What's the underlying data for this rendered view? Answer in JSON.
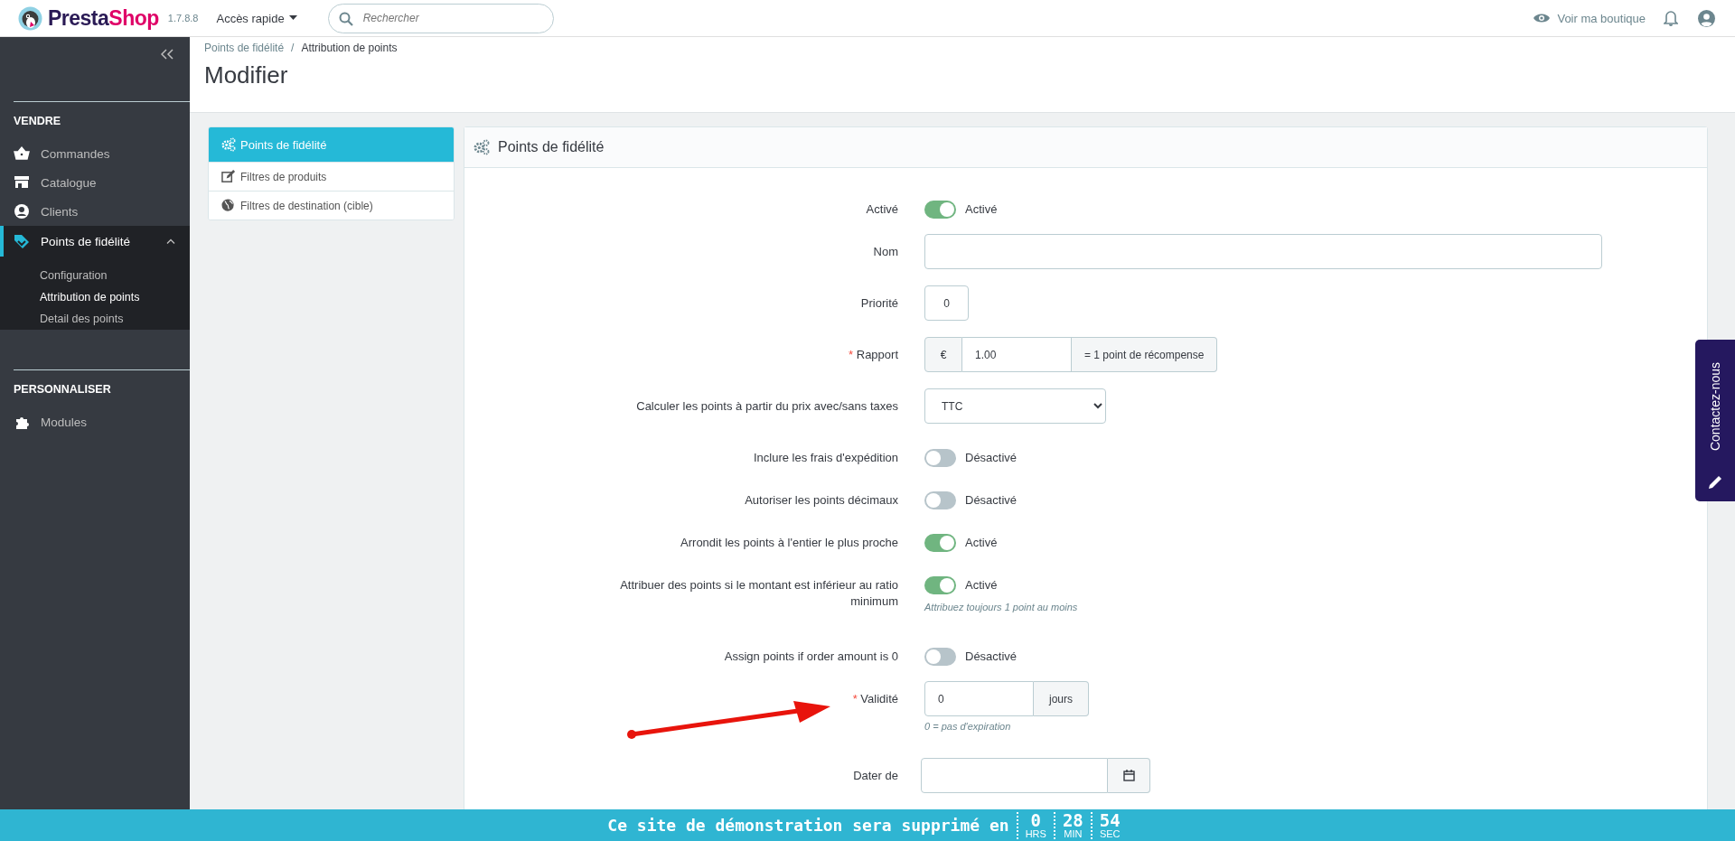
{
  "header": {
    "logo": {
      "dark_part": "Presta",
      "accent_part": "Shop"
    },
    "version": "1.7.8.8",
    "quick_access": "Accès rapide",
    "search": {
      "placeholder": "Rechercher"
    },
    "view_shop": "Voir ma boutique"
  },
  "sidebar": {
    "sections": [
      {
        "title": "VENDRE",
        "items": [
          {
            "label": "Commandes",
            "selected": false,
            "expanded": false
          },
          {
            "label": "Catalogue",
            "selected": false,
            "expanded": false
          },
          {
            "label": "Clients",
            "selected": false,
            "expanded": false
          },
          {
            "label": "Points de fidélité",
            "selected": true,
            "expanded": true,
            "children": [
              {
                "label": "Configuration",
                "selected": false
              },
              {
                "label": "Attribution de points",
                "selected": true
              },
              {
                "label": "Detail des points",
                "selected": false
              }
            ]
          }
        ]
      },
      {
        "title": "PERSONNALISER",
        "items": [
          {
            "label": "Modules",
            "selected": false,
            "expanded": false
          }
        ]
      }
    ]
  },
  "breadcrumb": {
    "separator": "/",
    "items": [
      "Points de fidélité",
      "Attribution de points"
    ]
  },
  "page_title": "Modifier",
  "tabs": [
    {
      "label": "Points de fidélité",
      "selected": true
    },
    {
      "label": "Filtres de produits",
      "selected": false
    },
    {
      "label": "Filtres de destination (cible)",
      "selected": false
    }
  ],
  "form": {
    "title": "Points de fidélité",
    "required_mark": "*",
    "rows": [
      {
        "kind": "switch",
        "label": "Activé",
        "required": false,
        "on": true,
        "state_text": "Activé"
      },
      {
        "kind": "text",
        "label": "Nom",
        "required": false,
        "value": ""
      },
      {
        "kind": "number",
        "label": "Priorité",
        "required": false,
        "value": "0"
      },
      {
        "kind": "ratio",
        "label": "Rapport",
        "required": true,
        "prefix": "€",
        "value": "1.00",
        "suffix": "= 1 point de récompense"
      },
      {
        "kind": "select",
        "label": "Calculer les points à partir du prix avec/sans taxes",
        "required": false,
        "value": "TTC"
      },
      {
        "kind": "switch",
        "label": "Inclure les frais d'expédition",
        "required": false,
        "on": false,
        "state_text": "Désactivé"
      },
      {
        "kind": "switch",
        "label": "Autoriser les points décimaux",
        "required": false,
        "on": false,
        "state_text": "Désactivé"
      },
      {
        "kind": "switch",
        "label": "Arrondit les points à l'entier le plus proche",
        "required": false,
        "on": true,
        "state_text": "Activé"
      },
      {
        "kind": "switch",
        "label": "Attribuer des points si le montant est inférieur au ratio minimum",
        "required": false,
        "on": true,
        "state_text": "Activé",
        "hint": "Attribuez toujours 1 point au moins"
      },
      {
        "kind": "switch",
        "label": "Assign points if order amount is 0",
        "required": false,
        "on": false,
        "state_text": "Désactivé"
      },
      {
        "kind": "days",
        "label": "Validité",
        "required": true,
        "value": "0",
        "suffix": "jours",
        "hint": "0 = pas d'expiration"
      },
      {
        "kind": "date",
        "label": "Dater de",
        "required": false,
        "value": ""
      }
    ]
  },
  "contact_tab": "Contactez-nous",
  "demo_bar": {
    "message": "Ce site de démonstration sera supprimé en",
    "countdown": [
      {
        "value": "0",
        "unit": "HRS"
      },
      {
        "value": "28",
        "unit": "MIN"
      },
      {
        "value": "54",
        "unit": "SEC"
      }
    ]
  }
}
